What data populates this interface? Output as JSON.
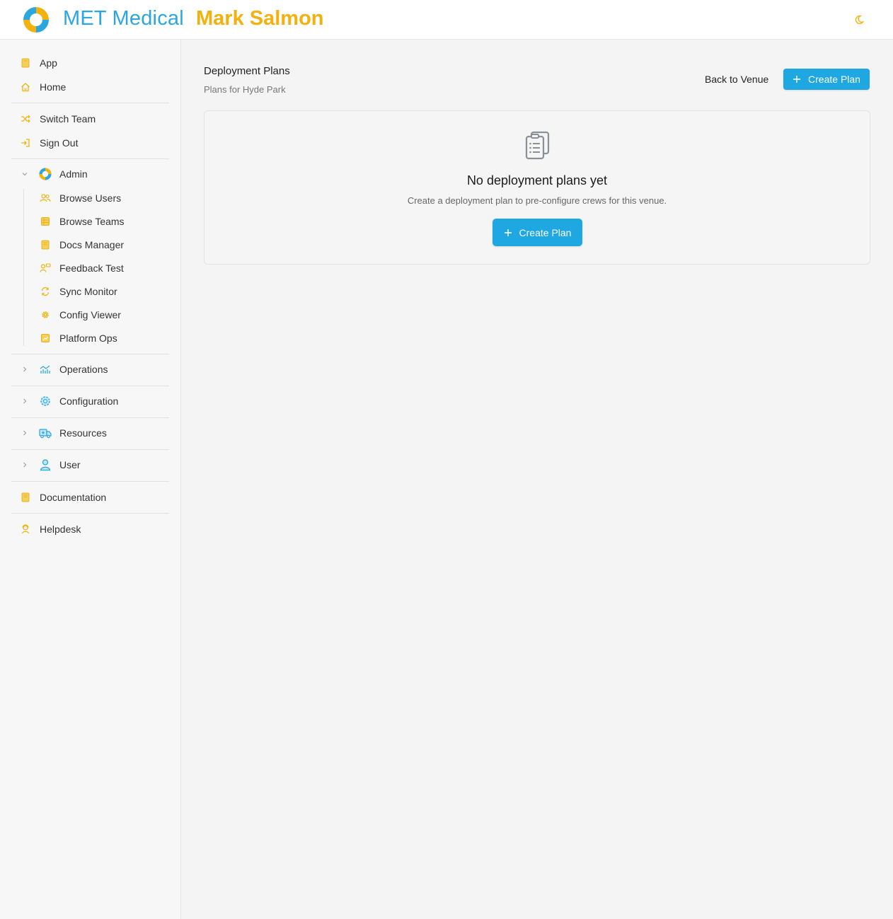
{
  "header": {
    "app_name": "MET Medical",
    "user_name": "Mark Salmon",
    "logo_icon": "met-medical-logo",
    "theme_icon": "moon-icon"
  },
  "sidebar": {
    "top_items": [
      {
        "label": "App",
        "icon": "book-icon"
      },
      {
        "label": "Home",
        "icon": "home-icon"
      }
    ],
    "account_items": [
      {
        "label": "Switch Team",
        "icon": "shuffle-icon"
      },
      {
        "label": "Sign Out",
        "icon": "sign-out-icon"
      }
    ],
    "admin": {
      "label": "Admin",
      "expanded": true,
      "items": [
        {
          "label": "Browse Users",
          "icon": "users-icon"
        },
        {
          "label": "Browse Teams",
          "icon": "table-icon"
        },
        {
          "label": "Docs Manager",
          "icon": "book-icon"
        },
        {
          "label": "Feedback Test",
          "icon": "feedback-icon"
        },
        {
          "label": "Sync Monitor",
          "icon": "sync-icon"
        },
        {
          "label": "Config Viewer",
          "icon": "gear-icon"
        },
        {
          "label": "Platform Ops",
          "icon": "chart-icon"
        }
      ]
    },
    "groups": [
      {
        "label": "Operations",
        "icon": "bar-chart-icon"
      },
      {
        "label": "Configuration",
        "icon": "gear-icon"
      },
      {
        "label": "Resources",
        "icon": "ambulance-icon"
      },
      {
        "label": "User",
        "icon": "user-icon"
      }
    ],
    "bottom_items": [
      {
        "label": "Documentation",
        "icon": "book-icon"
      },
      {
        "label": "Helpdesk",
        "icon": "helpdesk-icon"
      }
    ]
  },
  "main": {
    "title": "Deployment Plans",
    "subtitle": "Plans for Hyde Park",
    "back_label": "Back to Venue",
    "create_label": "Create Plan",
    "empty": {
      "icon": "clipboard-list-icon",
      "title": "No deployment plans yet",
      "text": "Create a deployment plan to pre-configure crews for this venue.",
      "button_label": "Create Plan"
    }
  },
  "colors": {
    "brand_blue": "#2aa7df",
    "brand_yellow": "#f2b10c",
    "primary_button": "#1ea7e1"
  }
}
